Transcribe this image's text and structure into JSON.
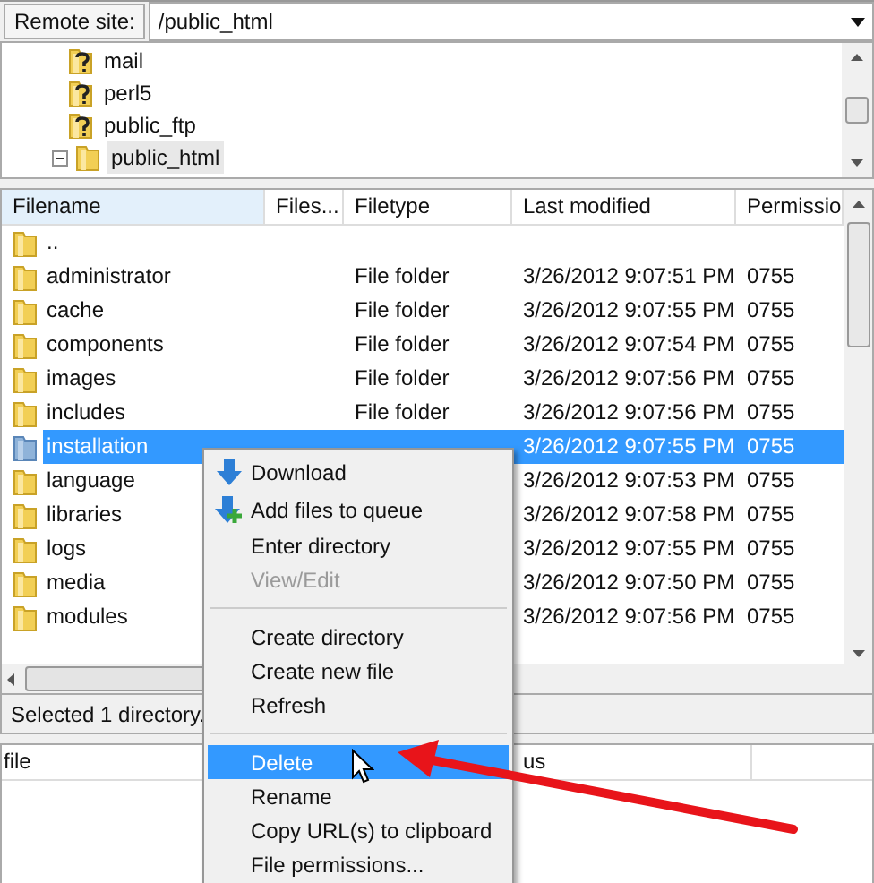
{
  "remote_site": {
    "label": "Remote site:",
    "path": "/public_html"
  },
  "tree": [
    {
      "name": "mail",
      "kind": "unknown",
      "selected": false
    },
    {
      "name": "perl5",
      "kind": "unknown",
      "selected": false
    },
    {
      "name": "public_ftp",
      "kind": "unknown",
      "selected": false
    },
    {
      "name": "public_html",
      "kind": "folder",
      "expanded": true,
      "selected": true
    }
  ],
  "table": {
    "columns": [
      "Filename",
      "Files...",
      "Filetype",
      "Last modified",
      "Permissio"
    ],
    "rows": [
      {
        "name": "..",
        "selected": false
      },
      {
        "name": "administrator",
        "filetype": "File folder",
        "modified": "3/26/2012 9:07:51 PM",
        "permissions": "0755",
        "selected": false
      },
      {
        "name": "cache",
        "filetype": "File folder",
        "modified": "3/26/2012 9:07:55 PM",
        "permissions": "0755",
        "selected": false
      },
      {
        "name": "components",
        "filetype": "File folder",
        "modified": "3/26/2012 9:07:54 PM",
        "permissions": "0755",
        "selected": false
      },
      {
        "name": "images",
        "filetype": "File folder",
        "modified": "3/26/2012 9:07:56 PM",
        "permissions": "0755",
        "selected": false
      },
      {
        "name": "includes",
        "filetype": "File folder",
        "modified": "3/26/2012 9:07:56 PM",
        "permissions": "0755",
        "selected": false
      },
      {
        "name": "installation",
        "modified": "3/26/2012 9:07:55 PM",
        "permissions": "0755",
        "selected": true
      },
      {
        "name": "language",
        "modified": "3/26/2012 9:07:53 PM",
        "permissions": "0755",
        "selected": false
      },
      {
        "name": "libraries",
        "modified": "3/26/2012 9:07:58 PM",
        "permissions": "0755",
        "selected": false
      },
      {
        "name": "logs",
        "modified": "3/26/2012 9:07:55 PM",
        "permissions": "0755",
        "selected": false
      },
      {
        "name": "media",
        "modified": "3/26/2012 9:07:50 PM",
        "permissions": "0755",
        "selected": false
      },
      {
        "name": "modules",
        "modified": "3/26/2012 9:07:56 PM",
        "permissions": "0755",
        "selected": false
      }
    ]
  },
  "status_bar": "Selected 1 directory.",
  "queue": {
    "columns": [
      "file",
      "us"
    ]
  },
  "context_menu": [
    {
      "kind": "download",
      "label": "Download",
      "disabled": false,
      "selected": false
    },
    {
      "kind": "enqueue",
      "label": "Add files to queue",
      "disabled": false,
      "selected": false
    },
    {
      "kind": "item",
      "label": "Enter directory",
      "disabled": false,
      "selected": false
    },
    {
      "kind": "item",
      "label": "View/Edit",
      "disabled": true,
      "selected": false
    },
    {
      "kind": "separator"
    },
    {
      "kind": "item",
      "label": "Create directory",
      "disabled": false,
      "selected": false
    },
    {
      "kind": "item",
      "label": "Create new file",
      "disabled": false,
      "selected": false
    },
    {
      "kind": "item",
      "label": "Refresh",
      "disabled": false,
      "selected": false
    },
    {
      "kind": "separator"
    },
    {
      "kind": "item",
      "label": "Delete",
      "disabled": false,
      "selected": true
    },
    {
      "kind": "item",
      "label": "Rename",
      "disabled": false,
      "selected": false
    },
    {
      "kind": "item",
      "label": "Copy URL(s) to clipboard",
      "disabled": false,
      "selected": false
    },
    {
      "kind": "item",
      "label": "File permissions...",
      "disabled": false,
      "selected": false
    }
  ]
}
